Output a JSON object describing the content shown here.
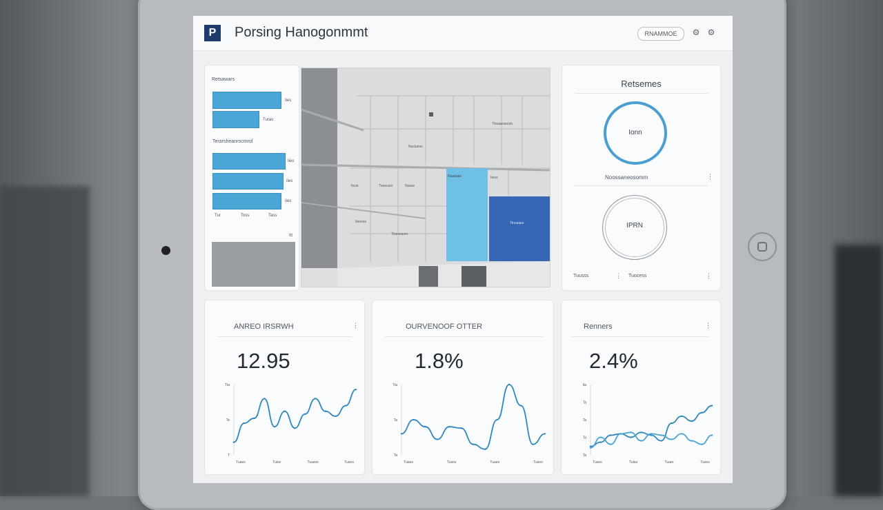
{
  "header": {
    "logo_letter": "P",
    "title": "Porsing Hanogonmmt",
    "action_button": "RNAMMOE",
    "icons": [
      "settings-icon",
      "settings-icon"
    ]
  },
  "left_panel": {
    "title": "Retsawars",
    "subheading": "Terarsheanrocmrol",
    "bars_top": [
      {
        "fraction": 0.92,
        "label": "Iies"
      },
      {
        "fraction": 0.62,
        "label": "Turas"
      }
    ],
    "bars_bottom": [
      {
        "fraction": 0.98,
        "label": "Iies"
      },
      {
        "fraction": 0.95,
        "label": "Iies"
      },
      {
        "fraction": 0.92,
        "label": "Iies"
      }
    ],
    "axis_labels": [
      "Tur",
      "Toss",
      "Tass"
    ],
    "block_tag": "Itt"
  },
  "map": {
    "labels": [
      "Tlosaanseom",
      "Nuclueso",
      "Nuadaes",
      "Itess",
      "Itcoir",
      "Tueessm",
      "Nusse",
      "Itsonss",
      "Tlsesesom",
      "Tlnusaes"
    ]
  },
  "right_panel": {
    "title": "Retsemes",
    "ring_top": {
      "label": "Ionn",
      "progress": 1.0
    },
    "subheading": "Noossaneosomm",
    "ring_bottom": {
      "label": "IPRN",
      "progress": 0.0
    },
    "footer": [
      "Tuusss",
      "Tuocess"
    ],
    "colors": {
      "ring": "#4b9fd0"
    }
  },
  "metrics": [
    {
      "title": "ANREO IRSRWH",
      "value": "12.95"
    },
    {
      "title": "OURVENOOF OTTER",
      "value": "1.8%"
    },
    {
      "title": "Renners",
      "value": "2.4%"
    }
  ],
  "chart_data": [
    {
      "type": "line",
      "x": [
        0,
        1,
        2,
        3,
        4,
        5,
        6,
        7,
        8,
        9,
        10,
        11,
        12
      ],
      "series": [
        {
          "values": [
            18,
            45,
            52,
            80,
            40,
            62,
            38,
            58,
            80,
            62,
            55,
            70,
            93
          ]
        }
      ],
      "ylim": [
        0,
        100
      ],
      "y_ticks": [
        "Tta",
        "Te",
        "T"
      ],
      "x_ticks": [
        "Tuaes",
        "Tuise",
        "Tuasos",
        "Tuseo"
      ]
    },
    {
      "type": "line",
      "x": [
        0,
        1,
        2,
        3,
        4,
        5,
        6,
        7,
        8,
        9,
        10,
        11,
        12
      ],
      "series": [
        {
          "values": [
            30,
            50,
            40,
            22,
            40,
            38,
            15,
            8,
            50,
            100,
            70,
            15,
            30
          ]
        }
      ],
      "ylim": [
        0,
        100
      ],
      "y_ticks": [
        "Tta",
        "Ta",
        "Ta"
      ],
      "x_ticks": [
        "Tuaes",
        "Tuses",
        "Tuaeo",
        "Tuseo"
      ]
    },
    {
      "type": "line",
      "x": [
        0,
        1,
        2,
        3,
        4,
        5,
        6,
        7,
        8,
        9,
        10,
        11,
        12
      ],
      "series": [
        {
          "values": [
            12,
            18,
            28,
            30,
            25,
            32,
            28,
            20,
            45,
            55,
            48,
            60,
            70
          ]
        },
        {
          "values": [
            10,
            25,
            15,
            30,
            32,
            20,
            30,
            28,
            22,
            30,
            20,
            15,
            28
          ]
        }
      ],
      "ylim": [
        0,
        100
      ],
      "y_ticks": [
        "Ita",
        "Ta",
        "Ta",
        "Ta",
        "Ta"
      ],
      "x_ticks": [
        "Tuses",
        "Tuisa",
        "Tuaer",
        "Tuses"
      ]
    }
  ]
}
